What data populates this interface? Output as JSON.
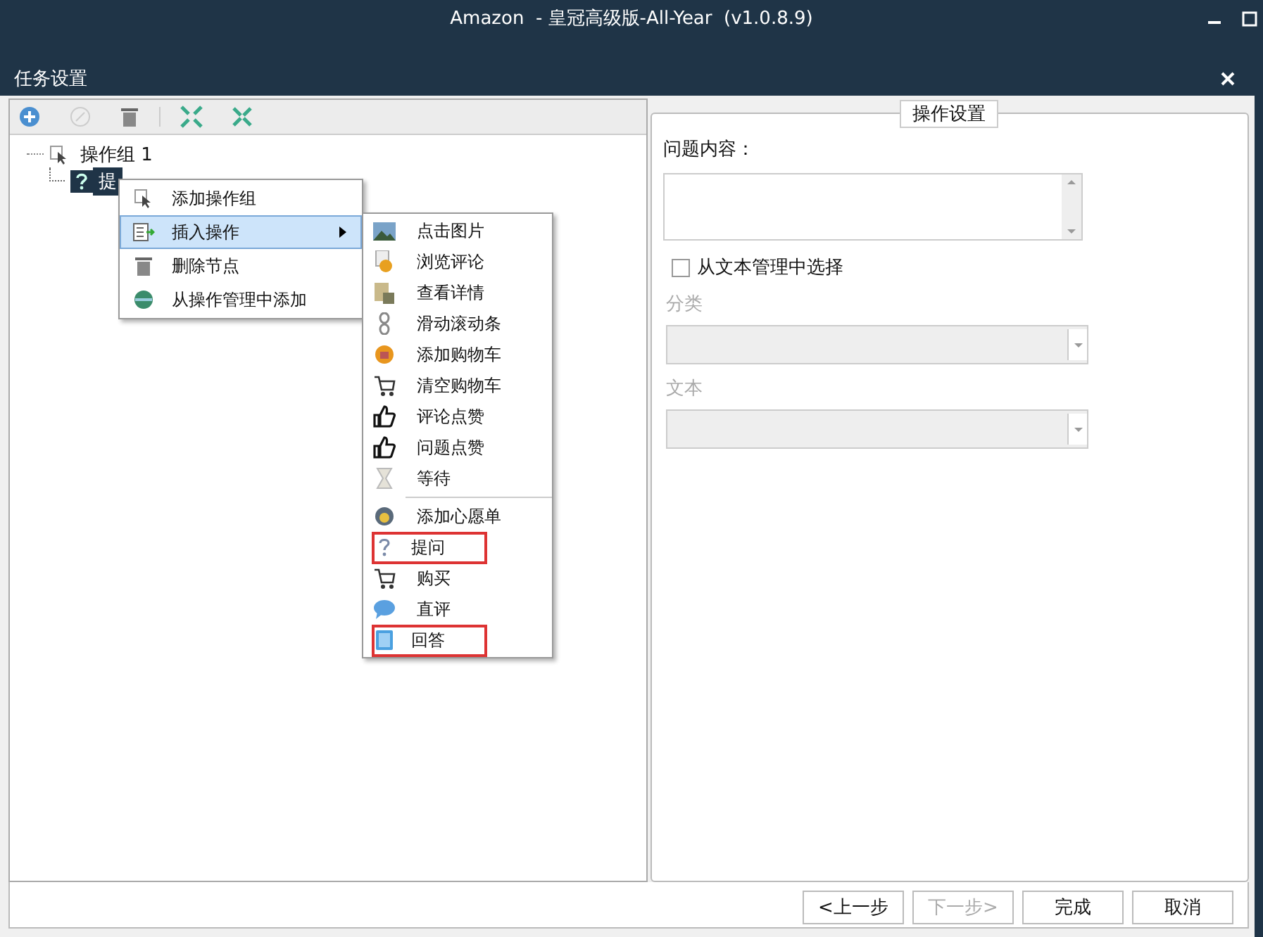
{
  "window": {
    "title": "Amazon  - 皇冠高级版-All-Year  (v1.0.8.9)"
  },
  "dialog": {
    "title": "任务设置"
  },
  "tree": {
    "items": [
      {
        "label": "操作组 1",
        "selected": false,
        "expanded": true,
        "children": [
          {
            "label": "提",
            "selected": true
          }
        ]
      }
    ]
  },
  "context_menu": {
    "items": [
      {
        "label": "添加操作组",
        "selected": false,
        "has_submenu": false
      },
      {
        "label": "插入操作",
        "selected": true,
        "has_submenu": true
      },
      {
        "label": "删除节点",
        "selected": false,
        "has_submenu": false
      },
      {
        "label": "从操作管理中添加",
        "selected": false,
        "has_submenu": false
      }
    ]
  },
  "submenu": {
    "groups": [
      [
        {
          "label": "点击图片",
          "highlighted": false
        },
        {
          "label": "浏览评论",
          "highlighted": false
        },
        {
          "label": "查看详情",
          "highlighted": false
        },
        {
          "label": "滑动滚动条",
          "highlighted": false
        },
        {
          "label": "添加购物车",
          "highlighted": false
        },
        {
          "label": "清空购物车",
          "highlighted": false
        },
        {
          "label": "评论点赞",
          "highlighted": false
        },
        {
          "label": "问题点赞",
          "highlighted": false
        },
        {
          "label": "等待",
          "highlighted": false
        }
      ],
      [
        {
          "label": "添加心愿单",
          "highlighted": false
        },
        {
          "label": "提问",
          "highlighted": true
        },
        {
          "label": "购买",
          "highlighted": false
        },
        {
          "label": "直评",
          "highlighted": false
        },
        {
          "label": "回答",
          "highlighted": true
        }
      ]
    ]
  },
  "settings": {
    "title": "操作设置",
    "question_label": "问题内容：",
    "checkbox": {
      "label": "从文本管理中选择",
      "checked": false
    },
    "fields": [
      {
        "label": "分类",
        "disabled": true
      },
      {
        "label": "文本",
        "disabled": true
      }
    ]
  },
  "buttons": [
    {
      "label": "<上一步",
      "disabled": false
    },
    {
      "label": "下一步>",
      "disabled": true
    },
    {
      "label": "完成",
      "disabled": false
    },
    {
      "label": "取消",
      "disabled": false
    }
  ]
}
